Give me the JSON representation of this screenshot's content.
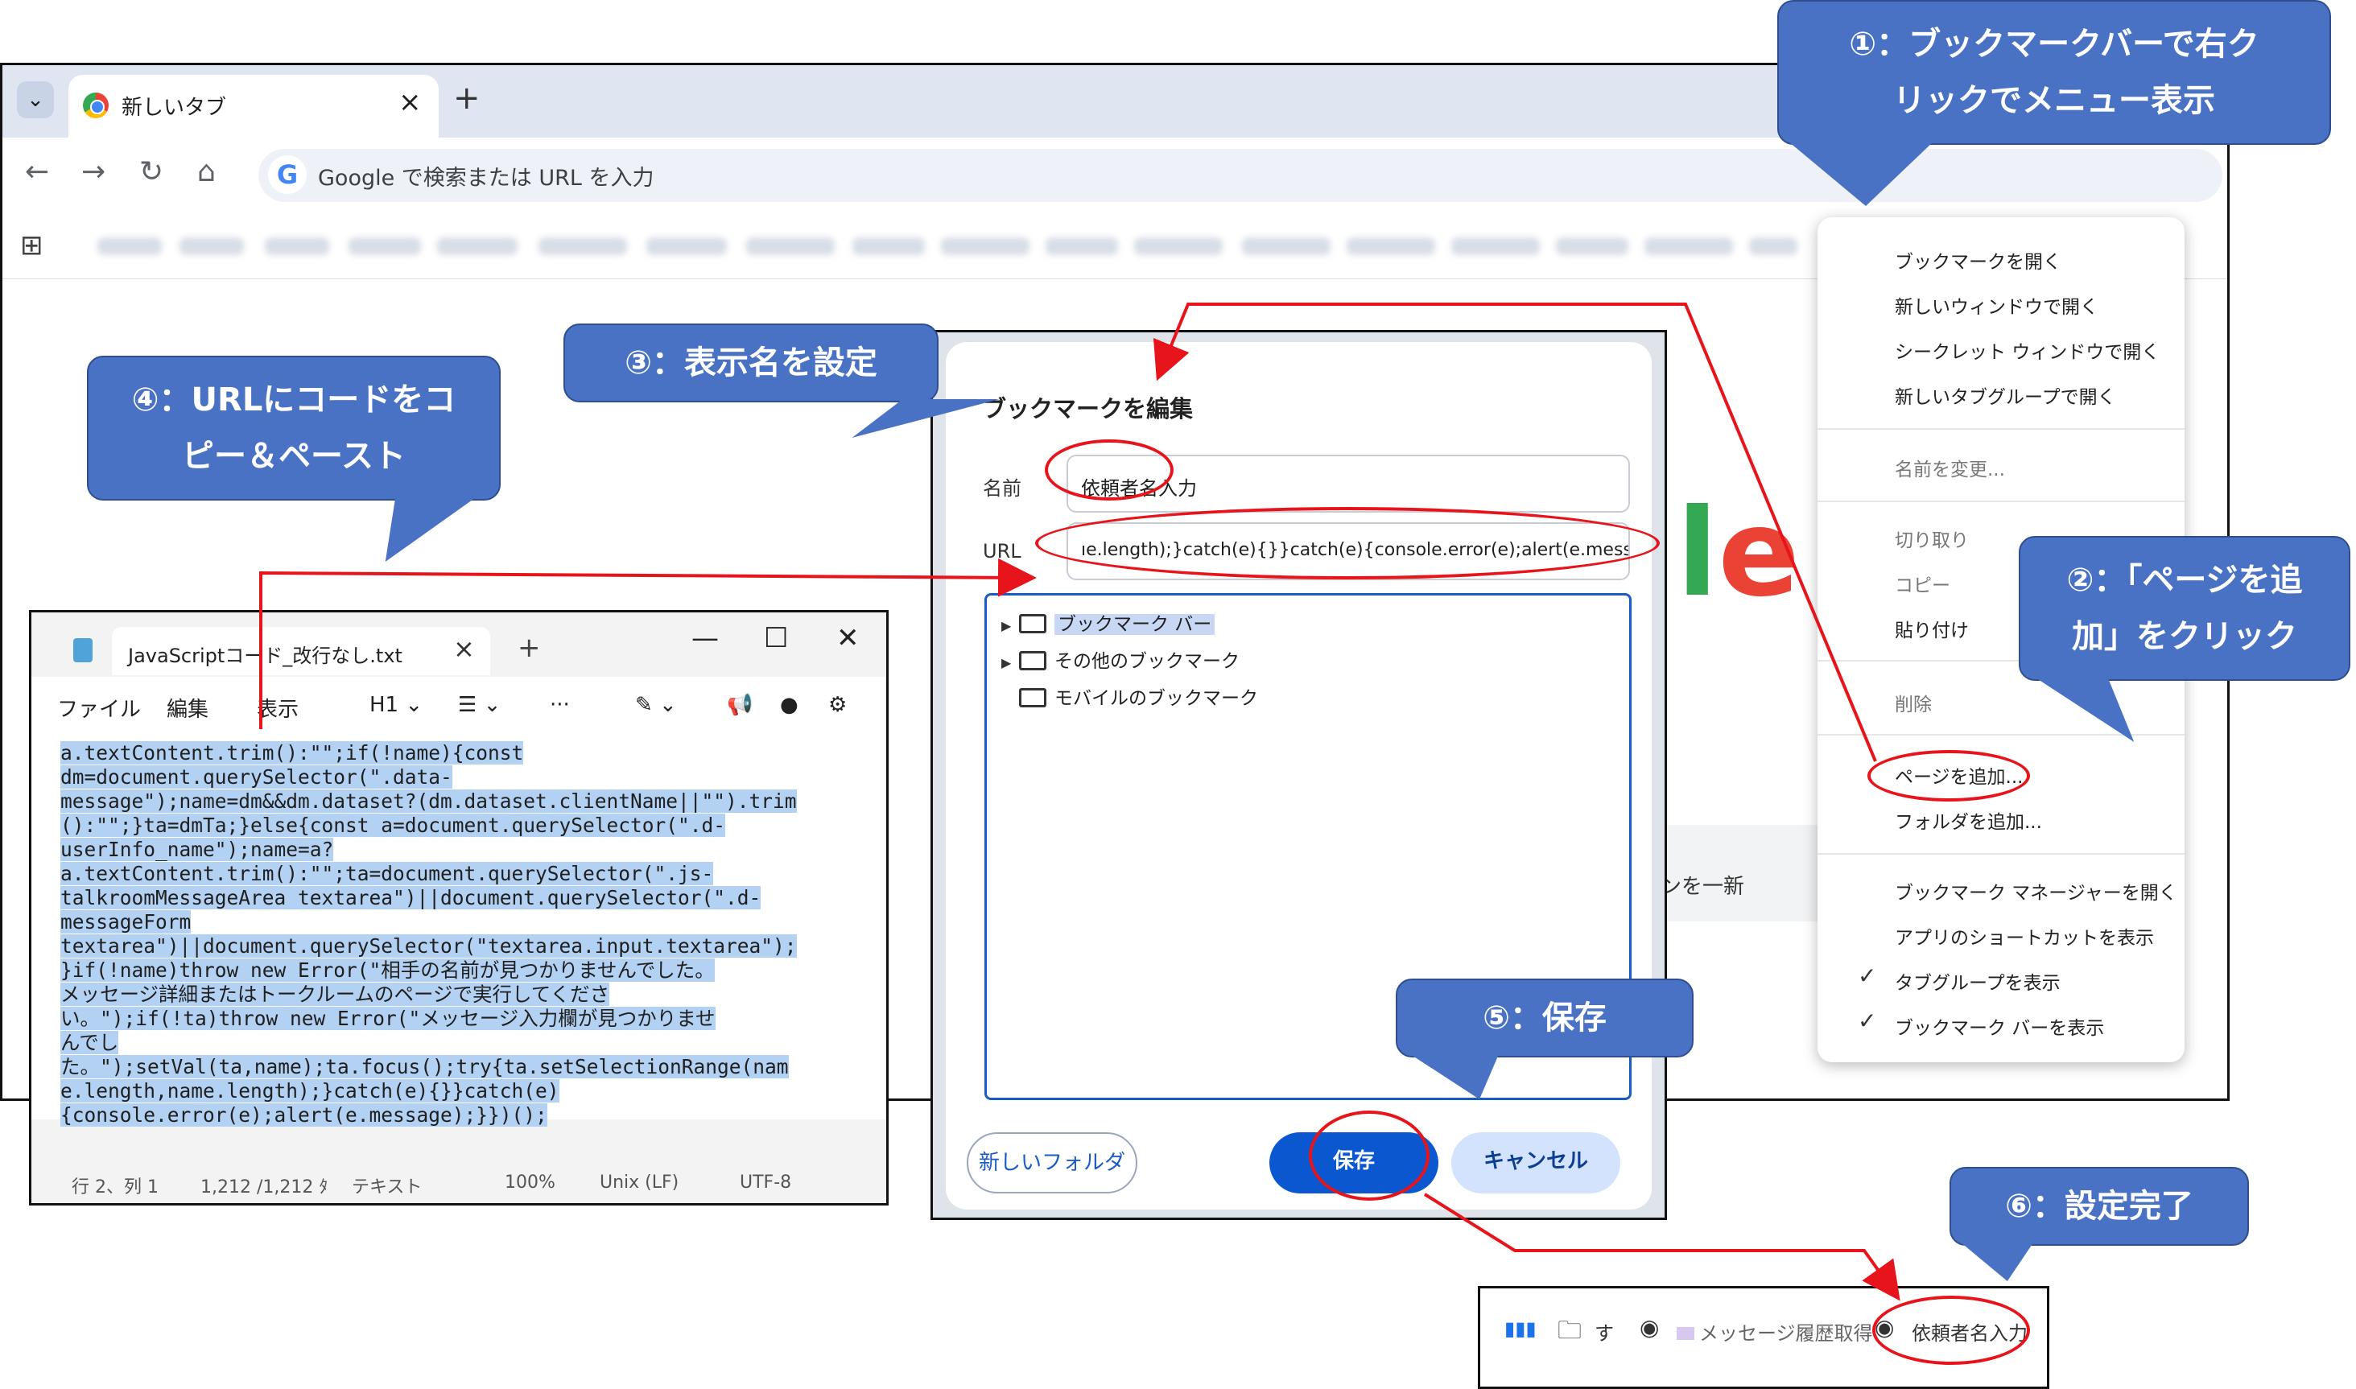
{
  "browser": {
    "tab_title": "新しいタブ",
    "omnibox_placeholder": "Google で検索または URL を入力",
    "ntp_shortcut_text": "ンを一新"
  },
  "context_menu": {
    "items": [
      {
        "label": "ブックマークを開く"
      },
      {
        "label": "新しいウィンドウで開く"
      },
      {
        "label": "シークレット ウィンドウで開く"
      },
      {
        "label": "新しいタブグループで開く"
      },
      {
        "label": "名前を変更..."
      },
      {
        "label": "切り取り"
      },
      {
        "label": "コピー"
      },
      {
        "label": "貼り付け"
      },
      {
        "label": "削除"
      },
      {
        "label": "ページを追加..."
      },
      {
        "label": "フォルダを追加..."
      },
      {
        "label": "ブックマーク マネージャーを開く"
      },
      {
        "label": "アプリのショートカットを表示"
      },
      {
        "label": "タブグループを表示"
      },
      {
        "label": "ブックマーク バーを表示"
      }
    ]
  },
  "dialog": {
    "title": "ブックマークを編集",
    "name_label": "名前",
    "name_value": "依頼者名入力",
    "url_label": "URL",
    "url_value": "ıe.length);}catch(e){}}catch(e){console.error(e);alert(e.message);}})();",
    "folders": [
      "ブックマーク バー",
      "その他のブックマーク",
      "モバイルのブックマーク"
    ],
    "new_folder_button": "新しいフォルダ",
    "save_button": "保存",
    "cancel_button": "キャンセル"
  },
  "notepad": {
    "tab_title": "JavaScriptコード_改行なし.txt",
    "menu": [
      "ファイル",
      "編集",
      "表示"
    ],
    "heading_select": "H1",
    "code_lines": [
      "a.textContent.trim():\"\";if(!name){const",
      "dm=document.querySelector(\".data-",
      "message\");name=dm&&dm.dataset?(dm.dataset.clientName||\"\").trim",
      "():\"\";}ta=dmTa;}else{const a=document.querySelector(\".d-",
      "userInfo_name\");name=a?",
      "a.textContent.trim():\"\";ta=document.querySelector(\".js-",
      "talkroomMessageArea textarea\")||document.querySelector(\".d-",
      "messageForm",
      "textarea\")||document.querySelector(\"textarea.input.textarea\");",
      "}if(!name)throw new Error(\"相手の名前が見つかりませんでした。",
      "メッセージ詳細またはトークルームのページで実行してくださ",
      "い。\");if(!ta)throw new Error(\"メッセージ入力欄が見つかりませ",
      "んでし",
      "た。\");setVal(ta,name);ta.focus();try{ta.setSelectionRange(nam",
      "e.length,name.length);}catch(e){}}catch(e)",
      "{console.error(e);alert(e.message);}})();"
    ],
    "status": {
      "position": "行 2、列 1",
      "chars": "1,212 /1,212 ﾀ",
      "format": "テキスト",
      "zoom": "100%",
      "line_ending": "Unix (LF)",
      "encoding": "UTF-8"
    }
  },
  "result_bar": {
    "items": [
      "す",
      "メッセージ履歴取得",
      "依頼者名入力"
    ]
  },
  "callouts": {
    "c1": [
      "①：ブックマークバーで右ク",
      "リックでメニュー表示"
    ],
    "c2": [
      "②：「ページを追",
      "加」をクリック"
    ],
    "c3": [
      "③：表示名を設定"
    ],
    "c4": [
      "④：URLにコードをコ",
      "ピー＆ペースト"
    ],
    "c5": [
      "⑤：保存"
    ],
    "c6": [
      "⑥：設定完了"
    ]
  },
  "colors": {
    "callout_fill": "#4a72c4",
    "annotation_red": "#e8141b",
    "save_button_blue": "#0b57d0",
    "selection_highlight": "#b3d1f2"
  }
}
